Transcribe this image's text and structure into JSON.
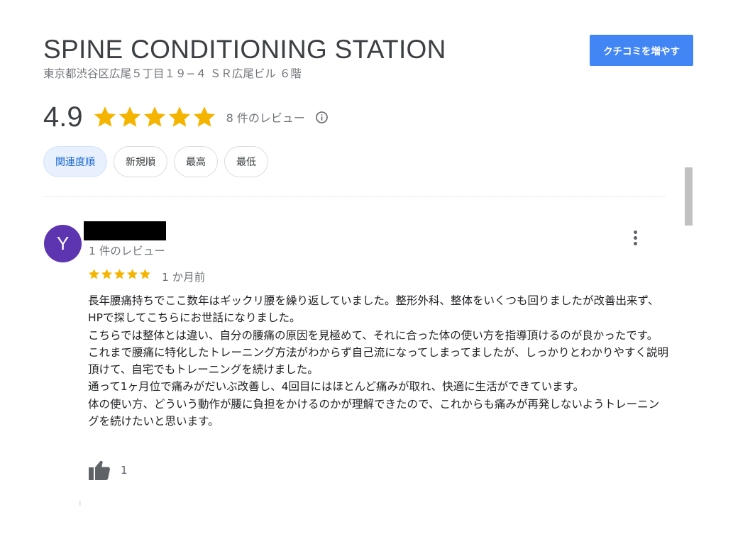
{
  "place": {
    "name": "SPINE CONDITIONING STATION",
    "address": "東京都渋谷区広尾５丁目１９−４ ＳＲ広尾ビル ６階",
    "cta_label": "クチコミを増やす"
  },
  "rating": {
    "value": "4.9",
    "stars": 5,
    "review_count_label": "8 件のレビュー"
  },
  "sort_options": [
    "関連度順",
    "新規順",
    "最高",
    "最低"
  ],
  "sort_selected": "関連度順",
  "review": {
    "avatar_initial": "Y",
    "reviewer_meta": "1 件のレビュー",
    "stars": 5,
    "date": "1 か月前",
    "paragraphs": [
      "長年腰痛持ちでここ数年はギックリ腰を繰り返していました。整形外科、整体をいくつも回りましたが改善出来ず、HPで探してこちらにお世話になりました。",
      "こちらでは整体とは違い、自分の腰痛の原因を見極めて、それに合った体の使い方を指導頂けるのが良かったです。",
      "これまで腰痛に特化したトレーニング方法がわからず自己流になってしまってましたが、しっかりとわかりやすく説明頂けて、自宅でもトレーニングを続けました。",
      "通って1ヶ月位で痛みがだいぶ改善し、4回目にはほとんど痛みが取れ、快適に生活ができています。",
      "体の使い方、どういう動作が腰に負担をかけるのかが理解できたので、これからも痛みが再発しないようトレーニングを続けたいと思います。"
    ],
    "like_count": "1"
  },
  "colors": {
    "star": "#f4b400",
    "accent": "#4285f4",
    "avatar": "#5e35b1",
    "chip_active_bg": "#e8f0fe"
  },
  "icons": [
    "star-icon",
    "info-icon",
    "more-vert-icon",
    "thumb-up-icon"
  ]
}
